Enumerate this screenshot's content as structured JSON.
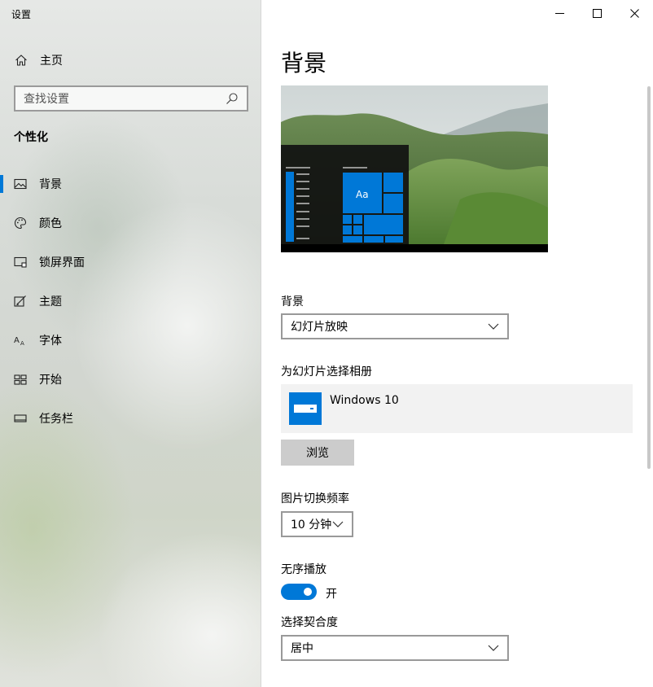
{
  "window": {
    "title": "设置"
  },
  "sidebar": {
    "home_label": "主页",
    "search_placeholder": "查找设置",
    "section_title": "个性化",
    "items": [
      {
        "label": "背景",
        "icon": "picture-icon",
        "active": true
      },
      {
        "label": "颜色",
        "icon": "palette-icon",
        "active": false
      },
      {
        "label": "锁屏界面",
        "icon": "lock-screen-icon",
        "active": false
      },
      {
        "label": "主题",
        "icon": "theme-icon",
        "active": false
      },
      {
        "label": "字体",
        "icon": "font-icon",
        "active": false
      },
      {
        "label": "开始",
        "icon": "start-icon",
        "active": false
      },
      {
        "label": "任务栏",
        "icon": "taskbar-icon",
        "active": false
      }
    ]
  },
  "main": {
    "page_title": "背景",
    "preview": {
      "tile_text": "Aa"
    },
    "background": {
      "label": "背景",
      "value": "幻灯片放映"
    },
    "album": {
      "label": "为幻灯片选择相册",
      "name": "Windows 10",
      "browse_label": "浏览"
    },
    "interval": {
      "label": "图片切换频率",
      "value": "10 分钟"
    },
    "shuffle": {
      "label": "无序播放",
      "state": "开",
      "on": true
    },
    "fit": {
      "label": "选择契合度",
      "value": "居中"
    }
  },
  "colors": {
    "accent": "#0078d7"
  }
}
